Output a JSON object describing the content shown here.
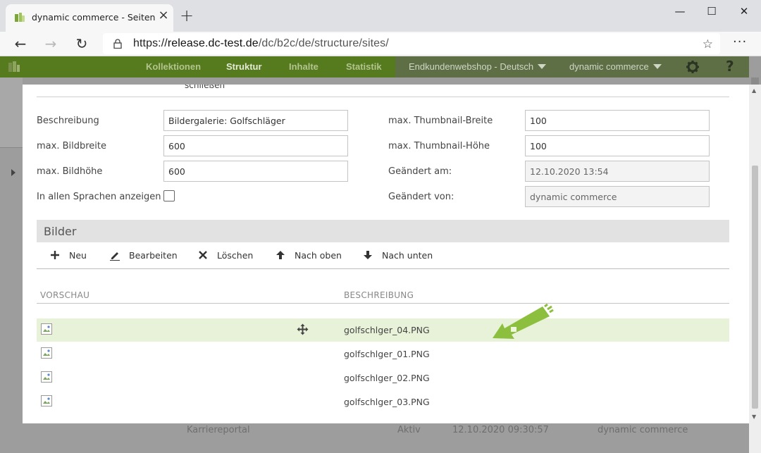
{
  "browser": {
    "tab_title": "dynamic commerce - Seiten",
    "url_prefix": "https://",
    "url_host": "release.dc-test.de",
    "url_path": "/dc/b2c/de/structure/sites/",
    "new_tab_symbol": "+",
    "more_symbol": "···"
  },
  "appnav": {
    "logo_text": "dynamic commerce",
    "menu": [
      "Kollektionen",
      "Struktur",
      "Inhalte",
      "Statistik"
    ],
    "active_index": 1,
    "shop": "Endkundenwebshop - Deutsch",
    "user": "dynamic commerce",
    "accent_color": "#567a1e"
  },
  "modal": {
    "cut_text": "schließen",
    "left_fields": [
      {
        "label": "Beschreibung",
        "value": "Bildergalerie: Golfschläger"
      },
      {
        "label": "max. Bildbreite",
        "value": "600"
      },
      {
        "label": "max. Bildhöhe",
        "value": "600"
      }
    ],
    "checkbox_label": "In allen Sprachen anzeigen",
    "checkbox_checked": false,
    "right_fields": [
      {
        "label": "max. Thumbnail-Breite",
        "value": "100",
        "readonly": false
      },
      {
        "label": "max. Thumbnail-Höhe",
        "value": "100",
        "readonly": false
      },
      {
        "label": "Geändert am:",
        "value": "12.10.2020 13:54",
        "readonly": true
      },
      {
        "label": "Geändert von:",
        "value": "dynamic commerce",
        "readonly": true
      }
    ],
    "section_title": "Bilder",
    "actions": [
      "Neu",
      "Bearbeiten",
      "Löschen",
      "Nach oben",
      "Nach unten"
    ],
    "columns": [
      "VORSCHAU",
      "BESCHREIBUNG"
    ],
    "rows": [
      {
        "description": "golfschlger_04.PNG",
        "selected": true
      },
      {
        "description": "golfschlger_01.PNG",
        "selected": false
      },
      {
        "description": "golfschlger_02.PNG",
        "selected": false
      },
      {
        "description": "golfschlger_03.PNG",
        "selected": false
      }
    ]
  },
  "background_row": {
    "name": "Karriereportal",
    "status": "Aktiv",
    "date": "12.10.2020 09:30:57",
    "user": "dynamic commerce"
  }
}
